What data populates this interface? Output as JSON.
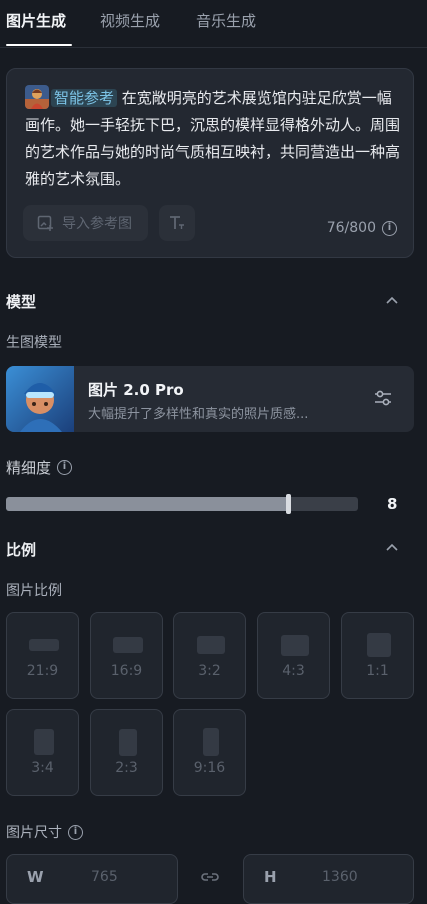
{
  "tabs": [
    {
      "label": "图片生成",
      "active": true
    },
    {
      "label": "视频生成",
      "active": false
    },
    {
      "label": "音乐生成",
      "active": false
    }
  ],
  "prompt": {
    "tag": "智能参考",
    "text": "在宽敞明亮的艺术展览馆内驻足欣赏一幅画作。她一手轻抚下巴，沉思的模样显得格外动人。周围的艺术作品与她的时尚气质相互映衬，共同营造出一种高雅的艺术氛围。",
    "import_label": "导入参考图",
    "counter": "76/800"
  },
  "model_section": {
    "title": "模型",
    "sub_label": "生图模型",
    "model_name": "图片 2.0 Pro",
    "model_desc": "大幅提升了多样性和真实的照片质感..."
  },
  "detail": {
    "label": "精细度",
    "value": "8",
    "fill_fraction": 0.8
  },
  "ratio_section": {
    "title": "比例",
    "sub_label": "图片比例",
    "ratios": [
      "21:9",
      "16:9",
      "3:2",
      "4:3",
      "1:1",
      "3:4",
      "2:3",
      "9:16"
    ]
  },
  "size": {
    "label": "图片尺寸",
    "w_prefix": "W",
    "w_value": "765",
    "h_prefix": "H",
    "h_value": "1360"
  },
  "colors": {
    "background": "#171b22",
    "card": "#232831",
    "accent_tag": "#7cc3e6"
  }
}
